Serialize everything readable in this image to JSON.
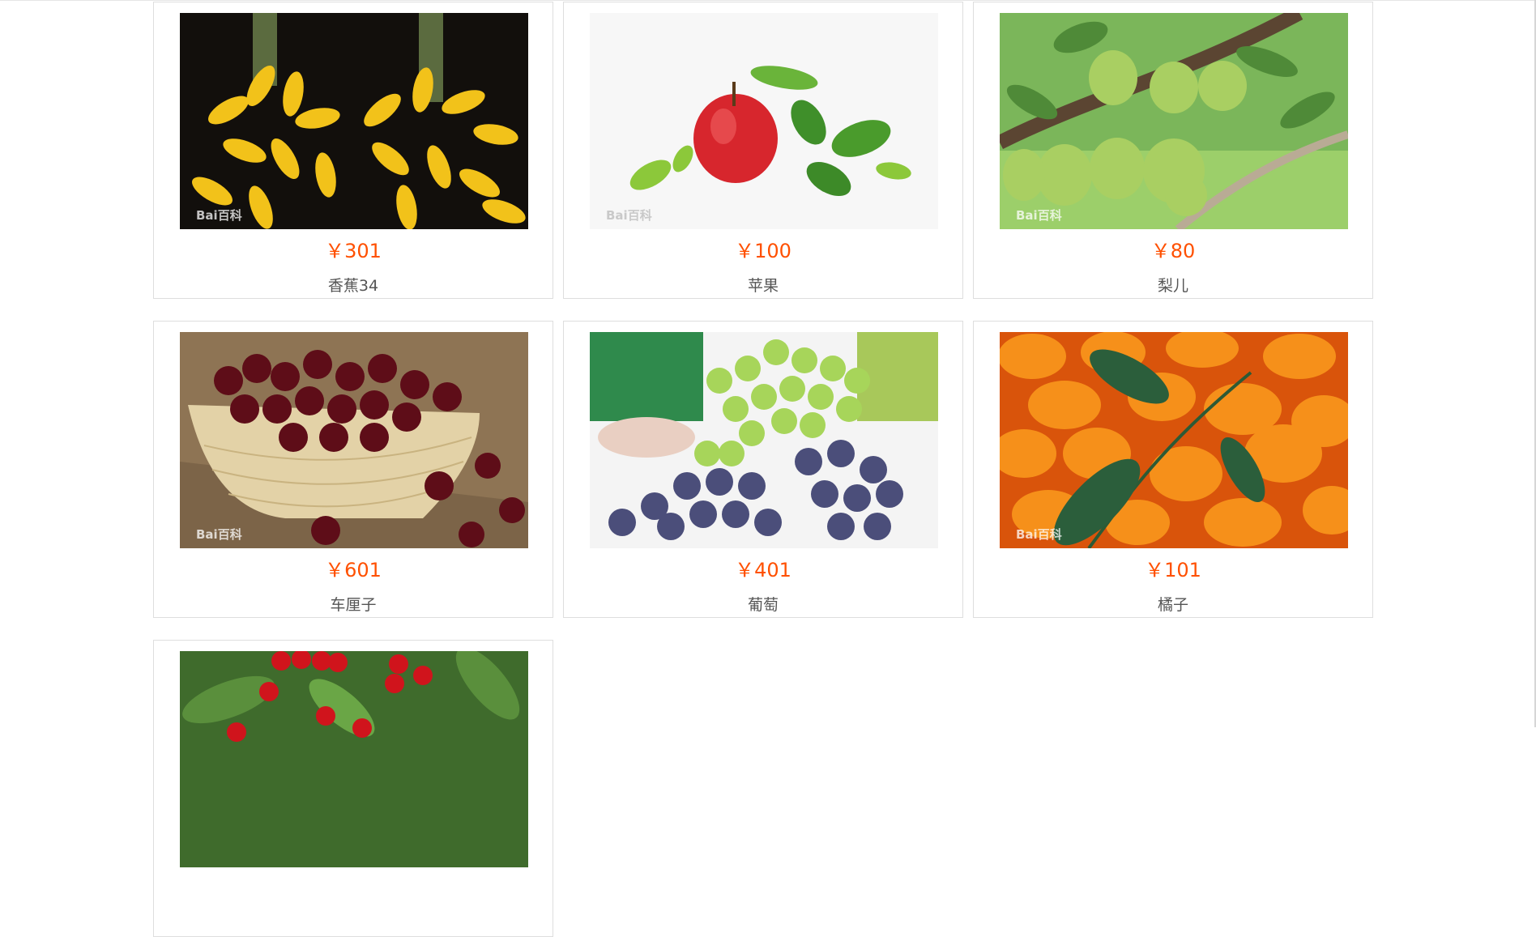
{
  "currency_symbol": "¥",
  "accent_color": "#ff5000",
  "products": [
    {
      "name": "香蕉34",
      "price": "￥301",
      "image": "banana-photo"
    },
    {
      "name": "苹果",
      "price": "￥100",
      "image": "apple-photo"
    },
    {
      "name": "梨儿",
      "price": "￥80",
      "image": "pear-photo"
    },
    {
      "name": "车厘子",
      "price": "￥601",
      "image": "cherries-basket-photo"
    },
    {
      "name": "葡萄",
      "price": "￥401",
      "image": "grapes-photo"
    },
    {
      "name": "橘子",
      "price": "￥101",
      "image": "kumquat-photo"
    },
    {
      "name": "",
      "price": "",
      "image": "cherry-tree-photo"
    }
  ]
}
